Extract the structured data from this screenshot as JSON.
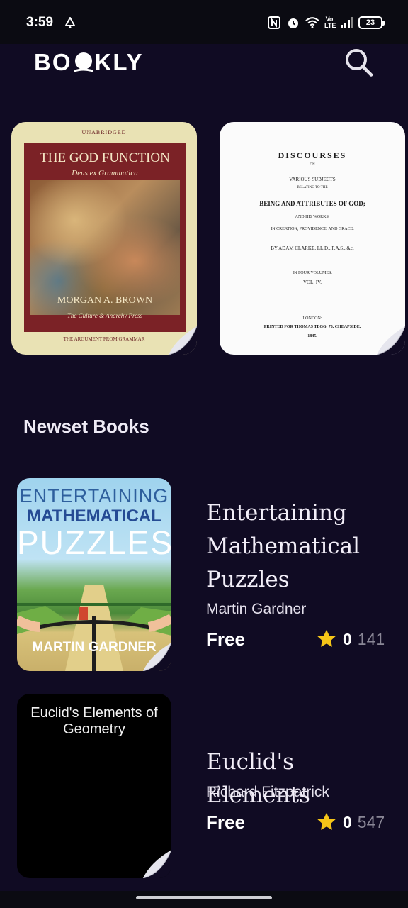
{
  "status_bar": {
    "time": "3:59",
    "battery": "23",
    "volte": "Vo LTE"
  },
  "app_bar": {
    "logo_prefix": "BO",
    "logo_suffix": "KLY",
    "search_icon": "search-icon"
  },
  "featured": [
    {
      "title": "THE GOD FUNCTION",
      "subtitle": "Deus ex Grammatica",
      "author": "MORGAN A. BROWN",
      "tag": "The Culture & Anarchy Press",
      "top_label": "UNABRIDGED",
      "bottom_label": "THE ARGUMENT FROM GRAMMAR"
    },
    {
      "line1": "DISCOURSES",
      "line2": "ON",
      "line3": "VARIOUS SUBJECTS",
      "line4": "RELATING TO THE",
      "line5": "BEING AND ATTRIBUTES OF GOD;",
      "line6": "AND HIS WORKS,",
      "line7": "IN CREATION, PROVIDENCE, AND GRACE.",
      "line8": "BY ADAM CLARKE, LL.D., F.A.S., &c.",
      "line9": "IN FOUR VOLUMES.",
      "line10": "VOL. IV.",
      "line11": "LONDON:",
      "line12": "PRINTED FOR THOMAS TEGG, 73, CHEAPSIDE.",
      "line13": "1845."
    }
  ],
  "section": {
    "title": "Newset Books"
  },
  "books": [
    {
      "title": "Entertaining Mathematical Puzzles",
      "author": "Martin Gardner",
      "price": "Free",
      "rating": "0",
      "count": "141",
      "cover": {
        "line1": "ENTERTAINING",
        "line2": "MATHEMATICAL",
        "line3": "PUZZLES",
        "author": "MARTIN GARDNER"
      }
    },
    {
      "title": "Euclid's Elements",
      "author": "Richard Fitzpatrick",
      "price": "Free",
      "rating": "0",
      "count": "547",
      "cover": {
        "title": "Euclid's Elements of Geometry"
      }
    }
  ],
  "colors": {
    "background": "#100b23",
    "star": "#f5c518",
    "muted": "#8a8796"
  }
}
